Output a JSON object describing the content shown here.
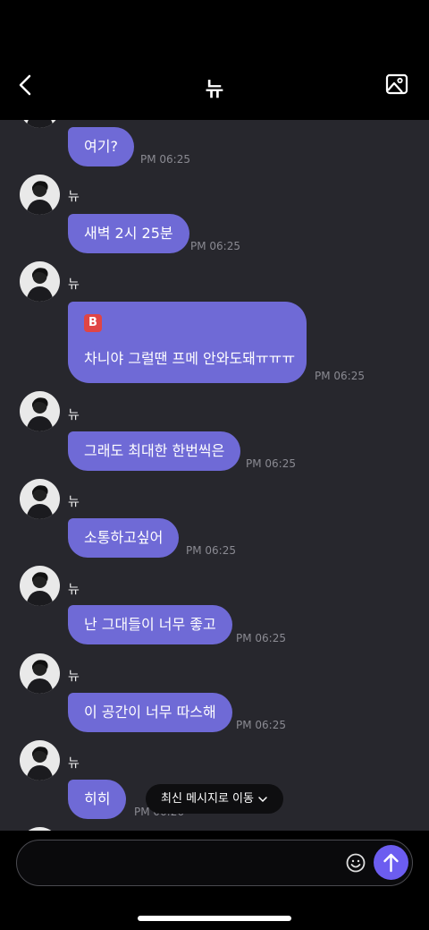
{
  "header": {
    "title": "뉴"
  },
  "messages": [
    {
      "text": "여기?",
      "time": "PM 06:25"
    },
    {
      "sender": "뉴",
      "text": "새벽 2시 25분",
      "time": "PM 06:25"
    },
    {
      "sender": "뉴",
      "badge": "B",
      "text": "차니야 그럴땐 프메 안와도돼ㅠㅠㅠ",
      "time": "PM 06:25"
    },
    {
      "sender": "뉴",
      "text": "그래도 최대한 한번씩은",
      "time": "PM 06:25"
    },
    {
      "sender": "뉴",
      "text": "소통하고싶어",
      "time": "PM 06:25"
    },
    {
      "sender": "뉴",
      "text": "난 그대들이 너무 좋고",
      "time": "PM 06:25"
    },
    {
      "sender": "뉴",
      "text": "이 공간이 너무 따스해",
      "time": "PM 06:25"
    },
    {
      "sender": "뉴",
      "text": "히히",
      "time": "PM 06:26"
    }
  ],
  "jump_button": {
    "label": "최신 메시지로 이동"
  },
  "input": {
    "placeholder": ""
  },
  "colors": {
    "bubble": "#6f6ad6",
    "chat_bg": "#27272d",
    "send": "#6c5df0"
  }
}
